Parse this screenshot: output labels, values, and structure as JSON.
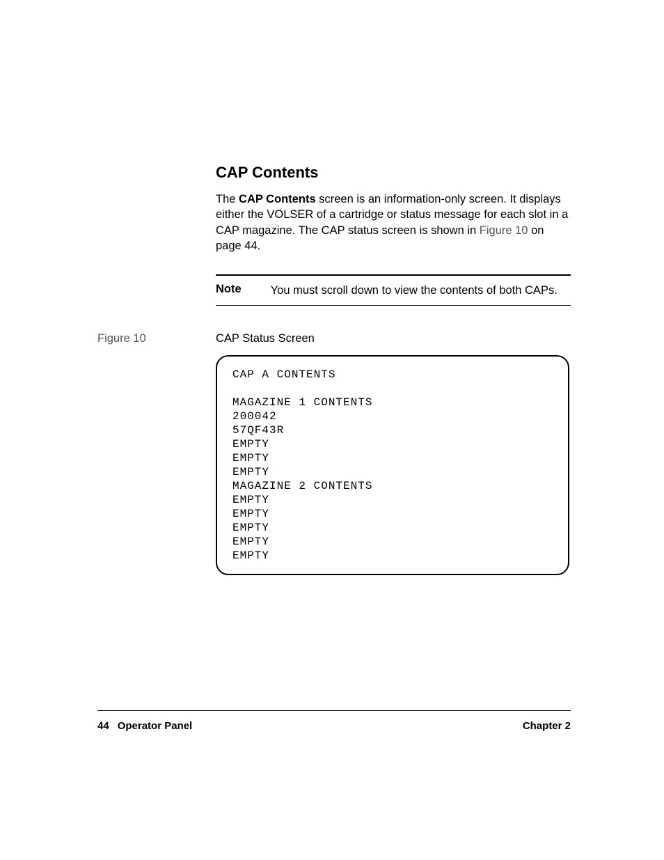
{
  "section": {
    "heading": "CAP Contents",
    "para_prefix": "The ",
    "para_bold": "CAP Contents",
    "para_after_bold": " screen is an information-only screen. It displays either the VOLSER of a cartridge or status message for each slot in a CAP magazine. The CAP status screen is shown in ",
    "para_fig_ref": "Figure 10",
    "para_suffix": " on page 44."
  },
  "note": {
    "label": "Note",
    "text": "You must scroll down to view the contents of both CAPs."
  },
  "figure": {
    "label": "Figure 10",
    "caption": "CAP Status Screen",
    "screen_lines": [
      "CAP A CONTENTS",
      "",
      "MAGAZINE 1 CONTENTS",
      "200042",
      "57QF43R",
      "EMPTY",
      "EMPTY",
      "EMPTY",
      "MAGAZINE 2 CONTENTS",
      "EMPTY",
      "EMPTY",
      "EMPTY",
      "EMPTY",
      "EMPTY"
    ]
  },
  "footer": {
    "page_number": "44",
    "title": "Operator Panel",
    "chapter": "Chapter 2"
  }
}
